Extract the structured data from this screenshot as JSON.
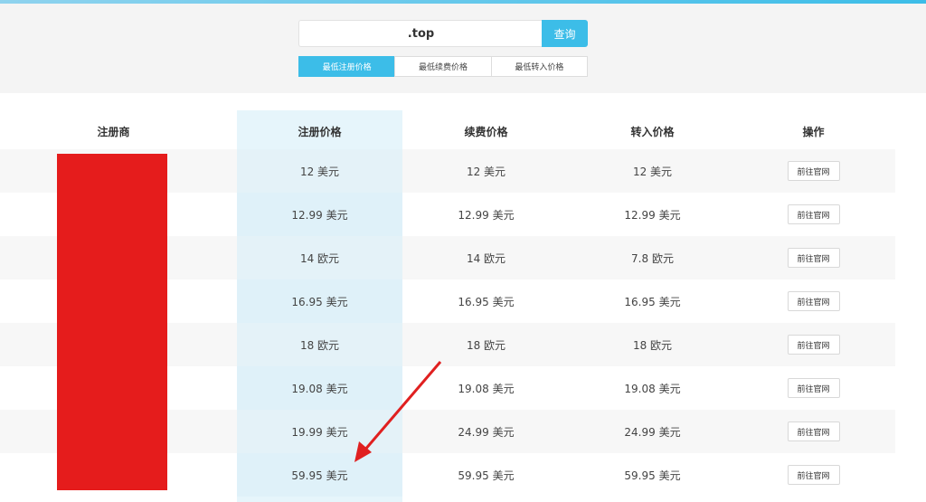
{
  "search": {
    "value": ".top",
    "button_label": "查询"
  },
  "tabs": [
    {
      "label": "最低注册价格",
      "active": true
    },
    {
      "label": "最低续费价格",
      "active": false
    },
    {
      "label": "最低转入价格",
      "active": false
    }
  ],
  "table": {
    "headers": [
      "注册商",
      "注册价格",
      "续费价格",
      "转入价格",
      "操作"
    ],
    "action_label": "前往官网",
    "rows": [
      {
        "register": "12 美元",
        "renew": "12 美元",
        "transfer": "12 美元"
      },
      {
        "register": "12.99 美元",
        "renew": "12.99 美元",
        "transfer": "12.99 美元"
      },
      {
        "register": "14 欧元",
        "renew": "14 欧元",
        "transfer": "7.8 欧元"
      },
      {
        "register": "16.95 美元",
        "renew": "16.95 美元",
        "transfer": "16.95 美元"
      },
      {
        "register": "18 欧元",
        "renew": "18 欧元",
        "transfer": "18 欧元"
      },
      {
        "register": "19.08 美元",
        "renew": "19.08 美元",
        "transfer": "19.08 美元"
      },
      {
        "register": "19.99 美元",
        "renew": "24.99 美元",
        "transfer": "24.99 美元"
      },
      {
        "register": "59.95 美元",
        "renew": "59.95 美元",
        "transfer": "59.95 美元"
      }
    ]
  },
  "colors": {
    "accent": "#3cbde8",
    "redaction": "#e51c1c",
    "arrow": "#e02020"
  }
}
